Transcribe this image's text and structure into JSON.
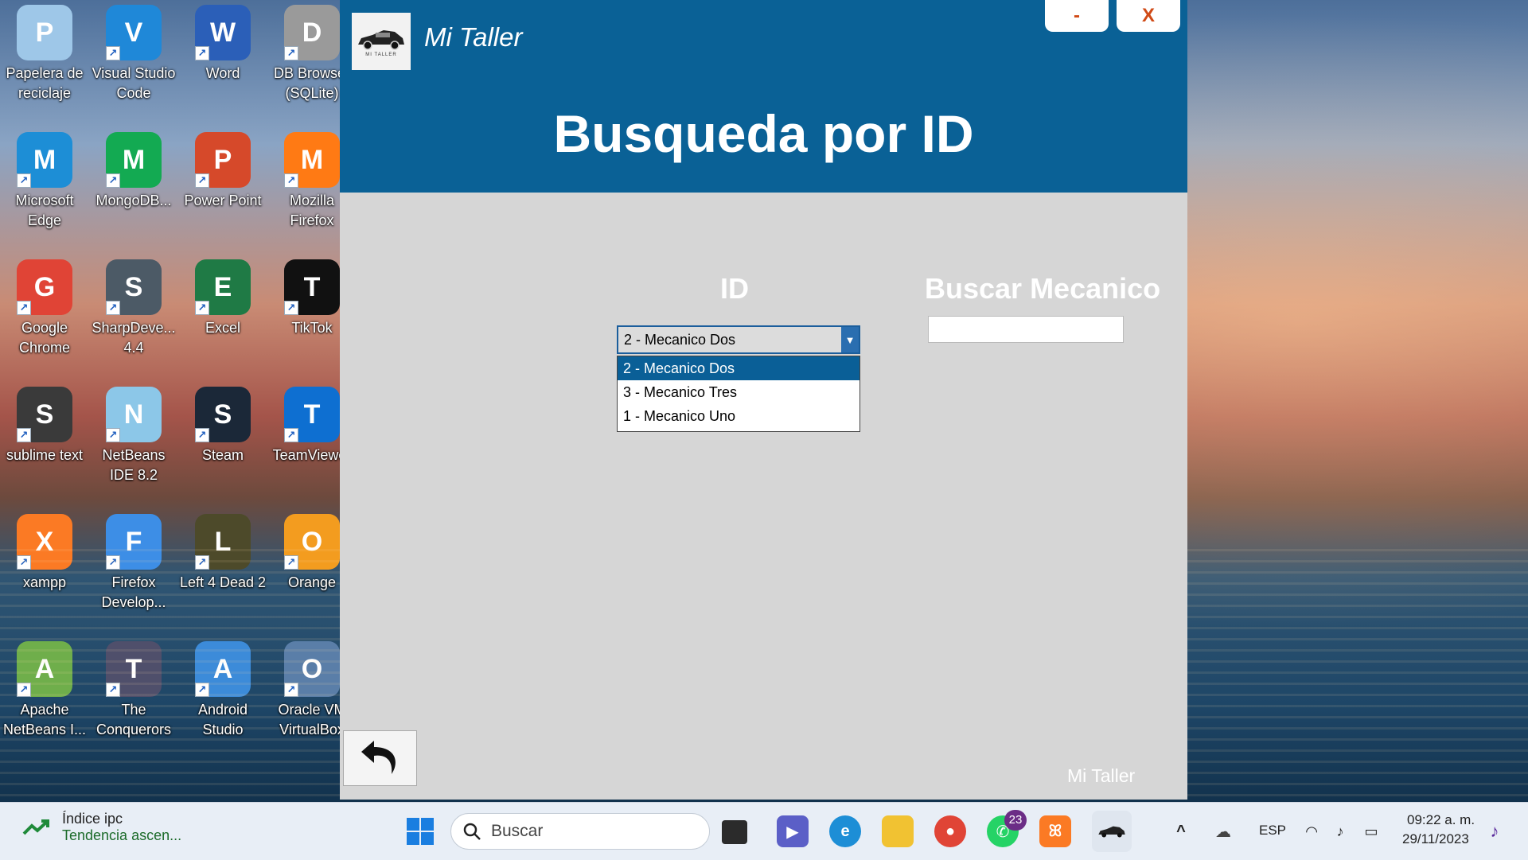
{
  "desktop": {
    "icons": [
      {
        "label": "Papelera de reciclaje",
        "icon": "recycle-bin-icon",
        "color": "#9ec7e8"
      },
      {
        "label": "Visual Studio Code",
        "icon": "vscode-icon",
        "color": "#1f88d8"
      },
      {
        "label": "Word",
        "icon": "word-icon",
        "color": "#2b5fb8"
      },
      {
        "label": "DB Browser (SQLite)",
        "icon": "database-icon",
        "color": "#9a9a9a"
      },
      {
        "label": "Microsoft Edge",
        "icon": "edge-icon",
        "color": "#1d8ed6"
      },
      {
        "label": "MongoDB...",
        "icon": "mongodb-icon",
        "color": "#13aa52"
      },
      {
        "label": "Power Point",
        "icon": "powerpoint-icon",
        "color": "#d6492a"
      },
      {
        "label": "Mozilla Firefox",
        "icon": "firefox-icon",
        "color": "#ff7a14"
      },
      {
        "label": "Google Chrome",
        "icon": "chrome-icon",
        "color": "#e04436"
      },
      {
        "label": "SharpDeve... 4.4",
        "icon": "sharpdevelop-icon",
        "color": "#4c5a66"
      },
      {
        "label": "Excel",
        "icon": "excel-icon",
        "color": "#1f7a45"
      },
      {
        "label": "TikTok",
        "icon": "tiktok-icon",
        "color": "#111111"
      },
      {
        "label": "sublime text",
        "icon": "sublime-icon",
        "color": "#3a3a3a"
      },
      {
        "label": "NetBeans IDE 8.2",
        "icon": "netbeans-icon",
        "color": "#8cc7e8"
      },
      {
        "label": "Steam",
        "icon": "steam-icon",
        "color": "#1b2838"
      },
      {
        "label": "TeamViewer",
        "icon": "teamviewer-icon",
        "color": "#0e6fd1"
      },
      {
        "label": "xampp",
        "icon": "xampp-icon",
        "color": "#fb7a24"
      },
      {
        "label": "Firefox Develop...",
        "icon": "firefox-developer-icon",
        "color": "#3d8ee6"
      },
      {
        "label": "Left 4 Dead 2",
        "icon": "left4dead-icon",
        "color": "#4d4a2a"
      },
      {
        "label": "Orange",
        "icon": "orange-icon",
        "color": "#f39c1f"
      },
      {
        "label": "Apache NetBeans I...",
        "icon": "apache-netbeans-icon",
        "color": "#6fae4b"
      },
      {
        "label": "The Conquerors",
        "icon": "conquerors-icon",
        "color": "#4f4f6b"
      },
      {
        "label": "Android Studio",
        "icon": "android-studio-icon",
        "color": "#3c8bd9"
      },
      {
        "label": "Oracle VM VirtualBox",
        "icon": "virtualbox-icon",
        "color": "#5a7ea8"
      }
    ]
  },
  "app": {
    "title": "Mi Taller",
    "logo_text": "MI TALLER",
    "minimize_label": "-",
    "close_label": "X",
    "heading": "Busqueda por ID",
    "id_label": "ID",
    "search_label": "Buscar Mecanico",
    "combo_value": "2 - Mecanico Dos",
    "options": [
      "2 - Mecanico Dos",
      "3 - Mecanico Tres",
      "1 - Mecanico Uno"
    ],
    "selected_option": "2 - Mecanico Dos",
    "search_value": "",
    "back_icon": "undo-arrow-icon",
    "footer": "Mi Taller",
    "colors": {
      "header": "#0a6196",
      "body": "#d6d6d6",
      "accent": "#d04a16"
    }
  },
  "taskbar": {
    "widget_title": "Índice ipc",
    "widget_subtitle": "Tendencia ascen...",
    "search_placeholder": "Buscar",
    "whatsapp_badge": "23",
    "language": "ESP",
    "time": "09:22 a. m.",
    "date": "29/11/2023"
  }
}
